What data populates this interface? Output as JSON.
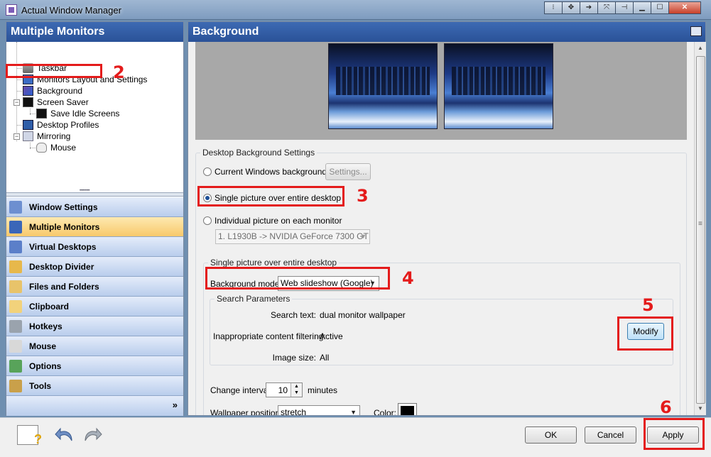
{
  "window": {
    "title": "Actual Window Manager"
  },
  "left_panel": {
    "header": "Multiple Monitors",
    "tree": [
      {
        "label": "Taskbar",
        "icon": "taskbar-icon"
      },
      {
        "label": "Monitors Layout and Settings",
        "icon": "monitor-icon"
      },
      {
        "label": "Background",
        "icon": "background-icon"
      },
      {
        "label": "Screen Saver",
        "icon": "screen-saver-icon"
      },
      {
        "label": "Save Idle Screens",
        "icon": "monitor-icon"
      },
      {
        "label": "Desktop Profiles",
        "icon": "desktop-profiles-icon"
      },
      {
        "label": "Mirroring",
        "icon": "mirroring-icon"
      },
      {
        "label": "Mouse",
        "icon": "mouse-icon"
      }
    ],
    "nav": [
      {
        "label": "Window Settings",
        "color": "#6d8fd0"
      },
      {
        "label": "Multiple Monitors",
        "color": "#3a66b8",
        "active": true
      },
      {
        "label": "Virtual Desktops",
        "color": "#5b7fc9"
      },
      {
        "label": "Desktop Divider",
        "color": "#e7b84b"
      },
      {
        "label": "Files and Folders",
        "color": "#e8c36a"
      },
      {
        "label": "Clipboard",
        "color": "#f2d27b"
      },
      {
        "label": "Hotkeys",
        "color": "#9aa3ad"
      },
      {
        "label": "Mouse",
        "color": "#d8d8d8"
      },
      {
        "label": "Options",
        "color": "#58a35a"
      },
      {
        "label": "Tools",
        "color": "#c9a04a"
      }
    ]
  },
  "right_panel": {
    "header": "Background",
    "desktop_settings": {
      "title": "Desktop Background Settings",
      "current_windows": "Current Windows background",
      "settings_button": "Settings...",
      "single_picture": "Single picture over entire desktop",
      "individual_picture": "Individual picture on each monitor",
      "monitor_select": "1. L1930B -> NVIDIA GeForce 7300 GT"
    },
    "single_section": {
      "title": "Single picture over entire desktop",
      "background_mode_label": "Background mode:",
      "background_mode_value": "Web slideshow (Google)",
      "search_params": {
        "title": "Search Parameters",
        "search_text_label": "Search text:",
        "search_text_value": "dual monitor wallpaper",
        "filtering_label": "Inappropriate content filtering:",
        "filtering_value": "Active",
        "image_size_label": "Image size:",
        "image_size_value": "All",
        "modify_button": "Modify"
      },
      "change_interval_label": "Change interval:",
      "change_interval_value": "10",
      "change_interval_unit": "minutes",
      "wallpaper_position_label": "Wallpaper position:",
      "wallpaper_position_value": "stretch",
      "color_label": "Color:",
      "color_value": "#000000"
    }
  },
  "bottom": {
    "ok": "OK",
    "cancel": "Cancel",
    "apply": "Apply"
  },
  "annotations": [
    "2",
    "3",
    "4",
    "5",
    "6"
  ]
}
